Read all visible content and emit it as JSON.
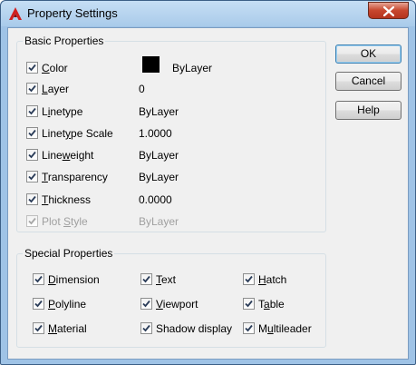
{
  "window": {
    "title": "Property Settings"
  },
  "basic": {
    "title": "Basic Properties",
    "rows": [
      {
        "pre": "",
        "ul": "C",
        "post": "olor",
        "value": "ByLayer",
        "checked": true,
        "disabled": false
      },
      {
        "pre": "",
        "ul": "L",
        "post": "ayer",
        "value": "0",
        "checked": true,
        "disabled": false
      },
      {
        "pre": "L",
        "ul": "i",
        "post": "netype",
        "value": "ByLayer",
        "checked": true,
        "disabled": false
      },
      {
        "pre": "Linet",
        "ul": "y",
        "post": "pe Scale",
        "value": "1.0000",
        "checked": true,
        "disabled": false
      },
      {
        "pre": "Line",
        "ul": "w",
        "post": "eight",
        "value": "ByLayer",
        "checked": true,
        "disabled": false
      },
      {
        "pre": "",
        "ul": "T",
        "post": "ransparency",
        "value": "ByLayer",
        "checked": true,
        "disabled": false
      },
      {
        "pre": "",
        "ul": "T",
        "post": "hickness",
        "value": "0.0000",
        "checked": true,
        "disabled": false
      },
      {
        "pre": "Plot ",
        "ul": "S",
        "post": "tyle",
        "value": "ByLayer",
        "checked": true,
        "disabled": true
      }
    ]
  },
  "special": {
    "title": "Special Properties",
    "items": [
      {
        "pre": "",
        "ul": "D",
        "post": "imension",
        "checked": true
      },
      {
        "pre": "",
        "ul": "T",
        "post": "ext",
        "checked": true
      },
      {
        "pre": "",
        "ul": "H",
        "post": "atch",
        "checked": true
      },
      {
        "pre": "",
        "ul": "P",
        "post": "olyline",
        "checked": true
      },
      {
        "pre": "",
        "ul": "V",
        "post": "iewport",
        "checked": true
      },
      {
        "pre": "T",
        "ul": "a",
        "post": "ble",
        "checked": true
      },
      {
        "pre": "",
        "ul": "M",
        "post": "aterial",
        "checked": true
      },
      {
        "pre": "Shadow display",
        "ul": "",
        "post": "",
        "checked": true
      },
      {
        "pre": "M",
        "ul": "u",
        "post": "ltileader",
        "checked": true
      }
    ]
  },
  "buttons": {
    "ok": "OK",
    "cancel": "Cancel",
    "help": "Help"
  },
  "colors": {
    "color_swatch": "#000000",
    "title_bar": "#b9d5ef",
    "close_button": "#c7462d",
    "app_icon": "#d11f1f"
  },
  "icons": {
    "app": "autocad-a-icon",
    "close": "close-icon",
    "check": "checkmark-icon"
  }
}
